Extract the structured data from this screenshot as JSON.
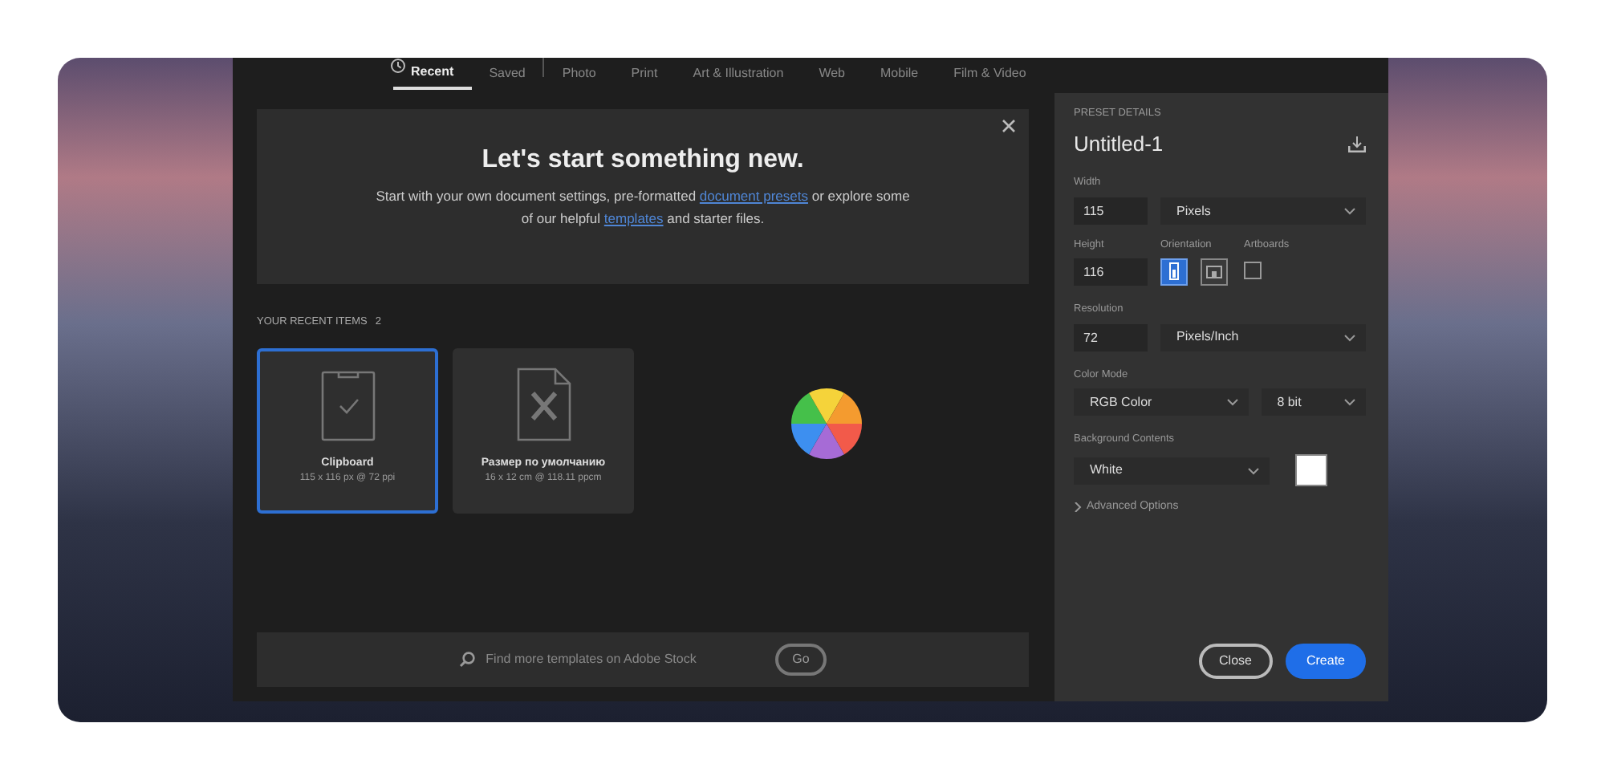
{
  "tabs": [
    {
      "label": "Recent",
      "selected": true
    },
    {
      "label": "Saved",
      "selected": false
    },
    {
      "label": "Photo",
      "selected": false,
      "divider_before": true
    },
    {
      "label": "Print",
      "selected": false
    },
    {
      "label": "Art & Illustration",
      "selected": false
    },
    {
      "label": "Web",
      "selected": false
    },
    {
      "label": "Mobile",
      "selected": false
    },
    {
      "label": "Film & Video",
      "selected": false
    }
  ],
  "hero": {
    "title": "Let's start something new.",
    "text": [
      {
        "kind": "text",
        "text": "Start with your own document settings, pre-formatted "
      },
      {
        "kind": "link",
        "text": "document presets"
      },
      {
        "kind": "text",
        "text": " or explore some of our helpful "
      },
      {
        "kind": "link",
        "text": "templates"
      },
      {
        "kind": "text",
        "text": " and starter files."
      }
    ]
  },
  "recent": {
    "heading": "YOUR RECENT ITEMS",
    "count": "2",
    "items": [
      {
        "kind": "clipboard",
        "name": "Clipboard",
        "detail": "115 x 116 px @ 72 ppi",
        "selected": true
      },
      {
        "kind": "document",
        "name": "Размер по умолчанию",
        "detail": "16 x 12 cm @ 118.11 ppcm",
        "selected": false
      }
    ]
  },
  "search": {
    "placeholder": "Find more templates on Adobe Stock",
    "button": "Go"
  },
  "preset": {
    "section_label": "PRESET DETAILS",
    "name": "Untitled-1",
    "width": {
      "label": "Width",
      "value": "115",
      "unit": "Pixels"
    },
    "height": {
      "label": "Height",
      "value": "116"
    },
    "orientation": {
      "label": "Orientation",
      "options": [
        {
          "kind": "portrait",
          "selected": true
        },
        {
          "kind": "landscape",
          "selected": false
        }
      ]
    },
    "artboards": {
      "label": "Artboards",
      "checked": false
    },
    "resolution": {
      "label": "Resolution",
      "value": "72",
      "unit": "Pixels/Inch"
    },
    "color_mode": {
      "label": "Color Mode",
      "mode": "RGB Color",
      "depth": "8 bit"
    },
    "background": {
      "label": "Background Contents",
      "value": "White",
      "color": "#ffffff"
    },
    "advanced": {
      "label": "Advanced Options",
      "expanded": false
    },
    "buttons": [
      {
        "kind": "secondary",
        "label": "Close"
      },
      {
        "kind": "primary",
        "label": "Create"
      }
    ]
  }
}
